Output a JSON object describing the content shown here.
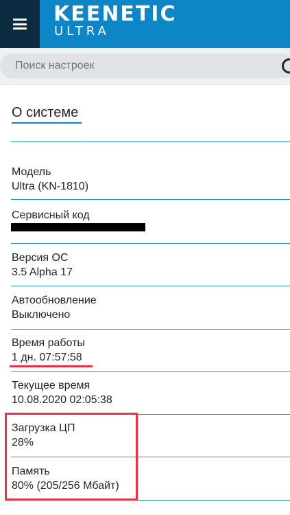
{
  "header": {
    "brand": "KEENETIC",
    "model_line": "ULTRA",
    "background_color": "#0d86c8",
    "menu_icon": "hamburger-icon"
  },
  "search": {
    "placeholder": "Поиск настроек",
    "icon": "search-icon"
  },
  "page": {
    "title": "О системе"
  },
  "items": [
    {
      "label": "Модель",
      "value": "Ultra (KN-1810)"
    },
    {
      "label": "Сервисный код",
      "value": ""
    },
    {
      "label": "Версия ОС",
      "value": "3.5 Alpha 17"
    },
    {
      "label": "Автообновление",
      "value": "Выключено"
    },
    {
      "label": "Время работы",
      "value": "1 дн. 07:57:58"
    },
    {
      "label": "Текущее время",
      "value": "10.08.2020 02:05:38"
    },
    {
      "label": "Загрузка ЦП",
      "value": "28%"
    },
    {
      "label": "Память",
      "value": "80% (205/256 Мбайт)"
    }
  ],
  "annotations": {
    "highlight_color": "#e8304a"
  }
}
